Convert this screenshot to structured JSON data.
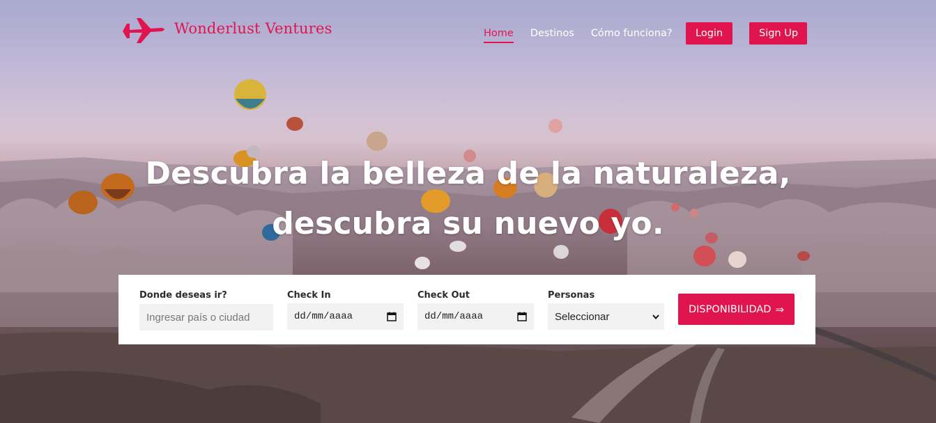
{
  "brand": {
    "name": "Wonderlust Ventures",
    "icon": "airplane-icon",
    "color": "#e0154f"
  },
  "nav": {
    "links": [
      {
        "label": "Home",
        "active": true
      },
      {
        "label": "Destinos",
        "active": false
      },
      {
        "label": "Cómo funciona?",
        "active": false
      }
    ],
    "login_label": "Login",
    "signup_label": "Sign Up"
  },
  "hero": {
    "headline_line1": "Descubra la belleza de la naturaleza,",
    "headline_line2": "descubra su nuevo yo."
  },
  "search": {
    "destination": {
      "label": "Donde deseas ir?",
      "placeholder": "Ingresar país o ciudad"
    },
    "check_in": {
      "label": "Check In",
      "value": "dd/mm/aaaa",
      "icon": "calendar-icon"
    },
    "check_out": {
      "label": "Check Out",
      "value": "dd/mm/aaaa",
      "icon": "calendar-icon"
    },
    "people": {
      "label": "Personas",
      "selected": "Seleccionar",
      "icon": "chevron-down-icon"
    },
    "submit_label": "DISPONIBILIDAD",
    "submit_arrow": "⇒"
  }
}
